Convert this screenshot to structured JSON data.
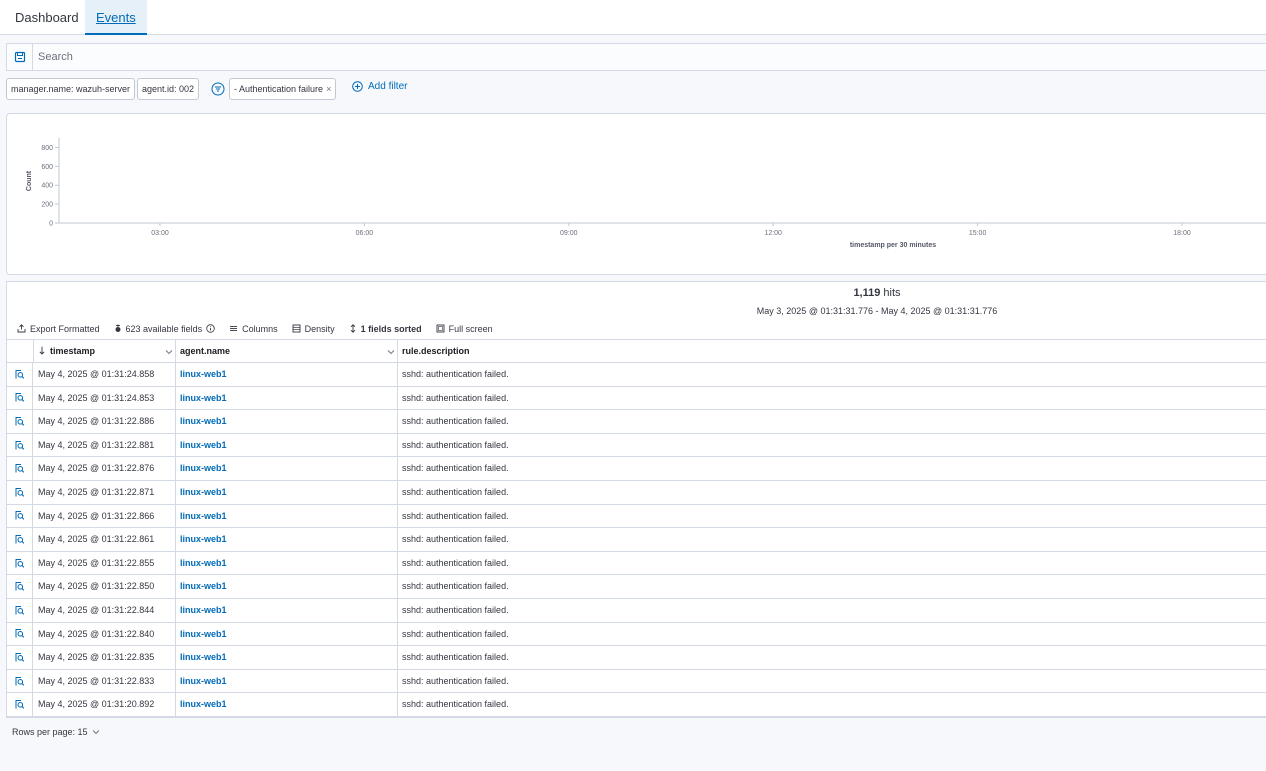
{
  "tabs": [
    {
      "label": "Dashboard",
      "active": false
    },
    {
      "label": "Events",
      "active": true
    }
  ],
  "search": {
    "placeholder": "Search",
    "value": ""
  },
  "filters": {
    "pills": [
      "manager.name: wazuh-server",
      "agent.id: 002",
      "- Authentication failure"
    ],
    "remove_symbol": "×",
    "add_label": "Add filter"
  },
  "chart_data": {
    "type": "bar",
    "title": "",
    "xlabel": "timestamp per 30 minutes",
    "ylabel": "Count",
    "y_ticks": [
      0,
      200,
      400,
      600,
      800
    ],
    "x_ticks": [
      "03:00",
      "06:00",
      "09:00",
      "12:00",
      "15:00",
      "18:00"
    ],
    "ylim": [
      0,
      900
    ],
    "grid": false,
    "series": []
  },
  "summary": {
    "hits_count": "1,119",
    "hits_label": "hits",
    "range": "May 3, 2025 @ 01:31:31.776 - May 4, 2025 @ 01:31:31.776"
  },
  "toolbar": {
    "export": "Export Formatted",
    "fields": "623 available fields",
    "columns": "Columns",
    "density": "Density",
    "sorted": "1 fields sorted",
    "fullscreen": "Full screen"
  },
  "table": {
    "columns": [
      "timestamp",
      "agent.name",
      "rule.description"
    ],
    "rows": [
      {
        "timestamp": "May 4, 2025 @ 01:31:24.858",
        "agent": "linux-web1",
        "description": "sshd: authentication failed."
      },
      {
        "timestamp": "May 4, 2025 @ 01:31:24.853",
        "agent": "linux-web1",
        "description": "sshd: authentication failed."
      },
      {
        "timestamp": "May 4, 2025 @ 01:31:22.886",
        "agent": "linux-web1",
        "description": "sshd: authentication failed."
      },
      {
        "timestamp": "May 4, 2025 @ 01:31:22.881",
        "agent": "linux-web1",
        "description": "sshd: authentication failed."
      },
      {
        "timestamp": "May 4, 2025 @ 01:31:22.876",
        "agent": "linux-web1",
        "description": "sshd: authentication failed."
      },
      {
        "timestamp": "May 4, 2025 @ 01:31:22.871",
        "agent": "linux-web1",
        "description": "sshd: authentication failed."
      },
      {
        "timestamp": "May 4, 2025 @ 01:31:22.866",
        "agent": "linux-web1",
        "description": "sshd: authentication failed."
      },
      {
        "timestamp": "May 4, 2025 @ 01:31:22.861",
        "agent": "linux-web1",
        "description": "sshd: authentication failed."
      },
      {
        "timestamp": "May 4, 2025 @ 01:31:22.855",
        "agent": "linux-web1",
        "description": "sshd: authentication failed."
      },
      {
        "timestamp": "May 4, 2025 @ 01:31:22.850",
        "agent": "linux-web1",
        "description": "sshd: authentication failed."
      },
      {
        "timestamp": "May 4, 2025 @ 01:31:22.844",
        "agent": "linux-web1",
        "description": "sshd: authentication failed."
      },
      {
        "timestamp": "May 4, 2025 @ 01:31:22.840",
        "agent": "linux-web1",
        "description": "sshd: authentication failed."
      },
      {
        "timestamp": "May 4, 2025 @ 01:31:22.835",
        "agent": "linux-web1",
        "description": "sshd: authentication failed."
      },
      {
        "timestamp": "May 4, 2025 @ 01:31:22.833",
        "agent": "linux-web1",
        "description": "sshd: authentication failed."
      },
      {
        "timestamp": "May 4, 2025 @ 01:31:20.892",
        "agent": "linux-web1",
        "description": "sshd: authentication failed."
      }
    ]
  },
  "pagination": {
    "rows_per_page": "Rows per page: 15"
  },
  "colors": {
    "accent": "#006bb8",
    "border": "#d3dae6",
    "text": "#343741",
    "background": "#f7f8fc"
  },
  "icons": [
    "save-query-icon",
    "filter-menu-icon",
    "add-filter-icon",
    "export-icon",
    "fields-icon",
    "info-icon",
    "columns-icon",
    "density-icon",
    "sort-icon",
    "fullscreen-icon",
    "sort-down-icon",
    "chevron-down-icon",
    "inspect-document-icon"
  ]
}
